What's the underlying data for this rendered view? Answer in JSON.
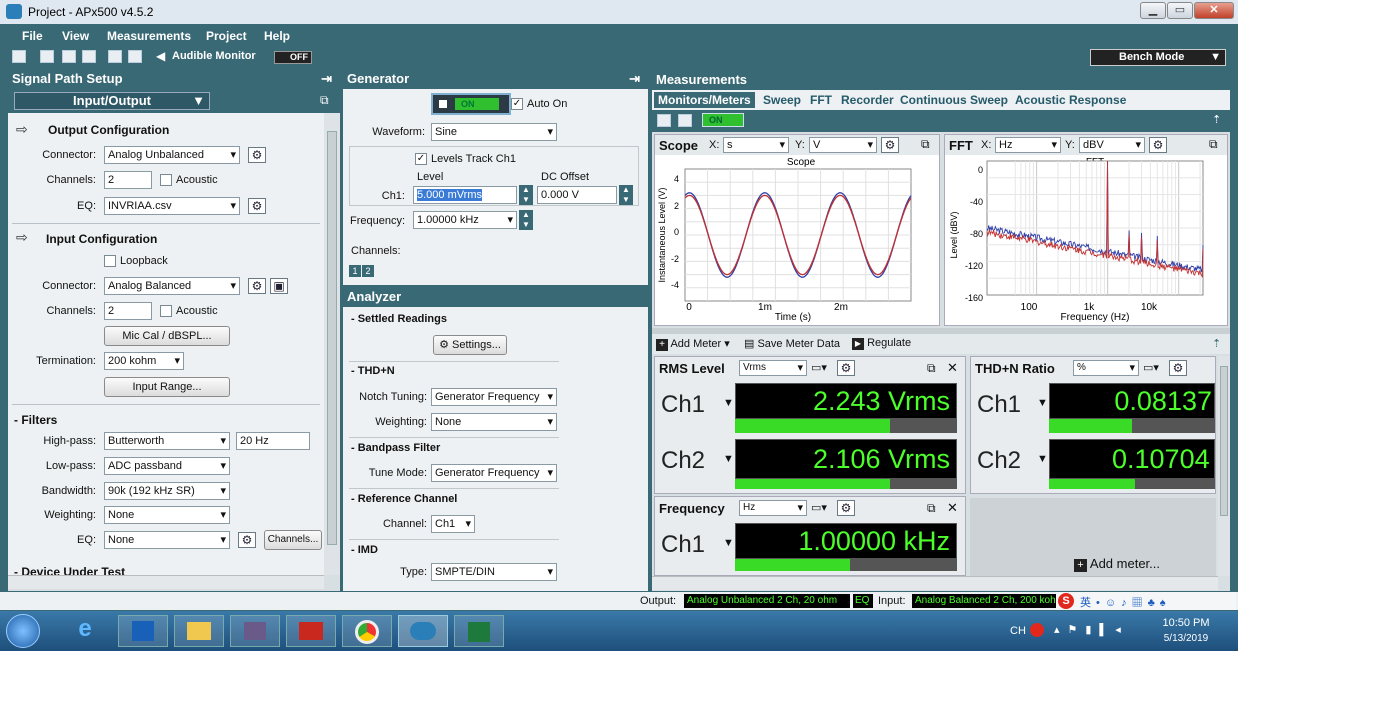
{
  "window": {
    "title": "Project - APx500 v4.5.2",
    "min": "▁",
    "max": "▭",
    "close": "✕"
  },
  "menu": [
    "File",
    "View",
    "Measurements",
    "Project",
    "Help"
  ],
  "toolbar": {
    "audible": "Audible Monitor",
    "off": "OFF",
    "bench": "Bench Mode"
  },
  "signal_path": {
    "header": "Signal Path Setup",
    "dropdown": "Input/Output",
    "output": {
      "title": "Output Configuration",
      "connector_label": "Connector:",
      "connector": "Analog Unbalanced",
      "channels_label": "Channels:",
      "channels": "2",
      "acoustic": "Acoustic",
      "eq_label": "EQ:",
      "eq": "INVRIAA.csv"
    },
    "input": {
      "title": "Input Configuration",
      "loopback": "Loopback",
      "connector_label": "Connector:",
      "connector": "Analog Balanced",
      "channels_label": "Channels:",
      "channels": "2",
      "acoustic": "Acoustic",
      "miccal": "Mic Cal / dBSPL...",
      "termination_label": "Termination:",
      "termination": "200 kohm",
      "range": "Input Range..."
    },
    "filters": {
      "title": "- Filters",
      "highpass_label": "High-pass:",
      "highpass": "Butterworth",
      "highpass_freq": "20 Hz",
      "lowpass_label": "Low-pass:",
      "lowpass": "ADC passband",
      "bandwidth_label": "Bandwidth:",
      "bandwidth": "90k (192 kHz SR)",
      "weighting_label": "Weighting:",
      "weighting": "None",
      "eq_label": "EQ:",
      "eq": "None",
      "channels_btn": "Channels..."
    },
    "dut": "- Device Under Test"
  },
  "generator": {
    "header": "Generator",
    "on": "ON",
    "autoon": "Auto On",
    "waveform_label": "Waveform:",
    "waveform": "Sine",
    "levels_track": "Levels Track Ch1",
    "level_hdr": "Level",
    "dc_hdr": "DC Offset",
    "ch1_label": "Ch1:",
    "level": "5.000 mVrms",
    "dc": "0.000 V",
    "freq_label": "Frequency:",
    "freq": "1.00000 kHz",
    "channels_label": "Channels:",
    "ch_a": "1",
    "ch_b": "2"
  },
  "analyzer": {
    "header": "Analyzer",
    "settled": "- Settled Readings",
    "settings": "Settings...",
    "thdn": "- THD+N",
    "notch_label": "Notch Tuning:",
    "notch": "Generator Frequency",
    "weighting_label": "Weighting:",
    "weighting": "None",
    "bandpass": "- Bandpass Filter",
    "tune_label": "Tune Mode:",
    "tune": "Generator Frequency",
    "ref": "- Reference Channel",
    "channel_label": "Channel:",
    "channel": "Ch1",
    "imd": "- IMD",
    "type_label": "Type:",
    "type": "SMPTE/DIN"
  },
  "measurements": {
    "header": "Measurements",
    "tabs": [
      "Monitors/Meters",
      "Sweep",
      "FFT",
      "Recorder",
      "Continuous Sweep",
      "Acoustic Response"
    ],
    "on": "ON"
  },
  "scope": {
    "label": "Scope",
    "xlbl": "X:",
    "x": "s",
    "ylbl": "Y:",
    "y": "V",
    "title": "Scope",
    "ylabel": "Instantaneous Level (V)",
    "xlabel": "Time (s)",
    "yticks": [
      "4",
      "2",
      "0",
      "-2",
      "-4"
    ],
    "xticks": [
      "0",
      "1m",
      "2m"
    ]
  },
  "fft": {
    "label": "FFT",
    "xlbl": "X:",
    "x": "Hz",
    "ylbl": "Y:",
    "y": "dBV",
    "title": "FFT",
    "ylabel": "Level (dBV)",
    "xlabel": "Frequency (Hz)",
    "yticks": [
      "0",
      "-40",
      "-80",
      "-120",
      "-160"
    ],
    "xticks": [
      "100",
      "1k",
      "10k"
    ]
  },
  "meter_toolbar": {
    "add": "Add Meter",
    "save": "Save Meter Data",
    "regulate": "Regulate"
  },
  "meters": {
    "rms": {
      "title": "RMS Level",
      "unit": "Vrms",
      "ch1": "Ch1",
      "v1": "2.243  Vrms",
      "ch2": "Ch2",
      "v2": "2.106  Vrms",
      "fill1": 0.7,
      "fill2": 0.7
    },
    "thdn": {
      "title": "THD+N Ratio",
      "unit": "%",
      "ch1": "Ch1",
      "v1": "0.08137",
      "ch2": "Ch2",
      "v2": "0.10704",
      "fill1": 0.5,
      "fill2": 0.52
    },
    "freq": {
      "title": "Frequency",
      "unit": "Hz",
      "ch1": "Ch1",
      "v1": "1.00000  kHz",
      "fill1": 0.52
    },
    "add": "Add meter..."
  },
  "status": {
    "output_label": "Output:",
    "output": "Analog Unbalanced 2 Ch, 20 ohm",
    "eq": "EQ",
    "input_label": "Input:",
    "input": "Analog Balanced 2 Ch, 200 kohm"
  },
  "taskbar": {
    "lang": "CH",
    "time": "10:50 PM",
    "date": "5/13/2019"
  },
  "chart_data": [
    {
      "type": "line",
      "title": "Scope",
      "xlabel": "Time (s)",
      "ylabel": "Instantaneous Level (V)",
      "xlim": [
        0,
        0.003
      ],
      "ylim": [
        -5,
        5
      ],
      "series": [
        {
          "name": "Ch1",
          "shape": "sine",
          "frequency_hz": 1000,
          "amplitude_v": 3.2,
          "color": "#2f3fa8"
        },
        {
          "name": "Ch2",
          "shape": "sine",
          "frequency_hz": 1000,
          "amplitude_v": 3.0,
          "color": "#c23030"
        }
      ]
    },
    {
      "type": "line",
      "title": "FFT",
      "xlabel": "Frequency (Hz)",
      "ylabel": "Level (dBV)",
      "xscale": "log",
      "xlim": [
        20,
        22000
      ],
      "ylim": [
        -160,
        0
      ],
      "series": [
        {
          "name": "Ch1",
          "color": "#2f3fa8",
          "fundamental_hz": 1000,
          "fundamental_dbv": 7,
          "noise_floor_dbv": [
            -80,
            -130
          ]
        },
        {
          "name": "Ch2",
          "color": "#c23030",
          "fundamental_hz": 1000,
          "fundamental_dbv": 6,
          "noise_floor_dbv": [
            -85,
            -135
          ]
        }
      ]
    }
  ]
}
